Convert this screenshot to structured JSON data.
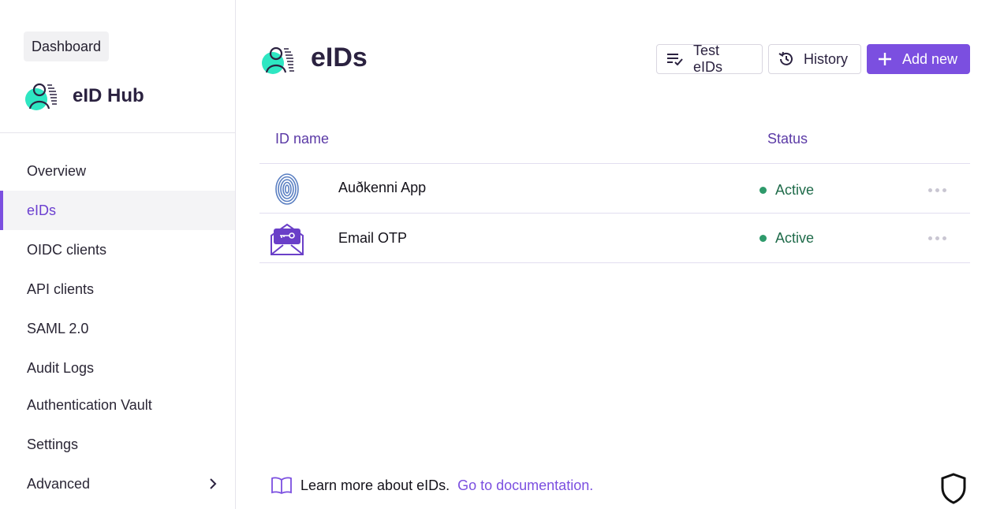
{
  "sidebar": {
    "dashboard_label": "Dashboard",
    "brand_name": "eID Hub",
    "items": [
      {
        "label": "Overview",
        "active": false
      },
      {
        "label": "eIDs",
        "active": true
      },
      {
        "label": "OIDC clients",
        "active": false
      },
      {
        "label": "API clients",
        "active": false
      },
      {
        "label": "SAML 2.0",
        "active": false
      },
      {
        "label": "Audit Logs",
        "active": false
      },
      {
        "label": "Authentication Vault",
        "active": false
      },
      {
        "label": "Settings",
        "active": false
      },
      {
        "label": "Advanced",
        "active": false
      }
    ]
  },
  "header": {
    "title": "eIDs",
    "test_label": "Test eIDs",
    "history_label": "History",
    "add_label": "Add new"
  },
  "table": {
    "columns": [
      "ID name",
      "Status"
    ],
    "rows": [
      {
        "name": "Auðkenni App",
        "status": "Active",
        "icon": "fingerprint-icon"
      },
      {
        "name": "Email OTP",
        "status": "Active",
        "icon": "email-key-icon"
      }
    ]
  },
  "footer": {
    "text": "Learn more about eIDs.",
    "link": "Go to documentation."
  },
  "colors": {
    "accent": "#7b4fe0",
    "status_active": "#2e9a6b",
    "header_text": "#5b3aa6",
    "logo_teal": "#2ee6c2"
  }
}
